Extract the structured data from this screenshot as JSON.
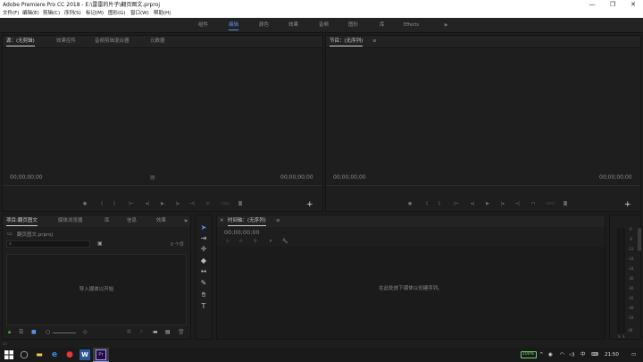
{
  "window": {
    "title": "Adobe Premiere Pro CC 2018 - E:\\雷雷的片子\\翻页图文.prproj",
    "controls": [
      "—",
      "❐",
      "✕"
    ]
  },
  "menu": [
    "文件(F)",
    "编辑(E)",
    "剪辑(C)",
    "序列(S)",
    "标记(M)",
    "图形(G)",
    "窗口(W)",
    "帮助(H)"
  ],
  "workspaces": {
    "tabs": [
      "组件",
      "编辑",
      "颜色",
      "效果",
      "音频",
      "图形",
      "库",
      "Effects"
    ],
    "active": "编辑",
    "overflow": "»"
  },
  "source_panel": {
    "tabs": [
      "源：(无剪辑)",
      "效果控件",
      "音频剪辑混合器",
      "元数据"
    ],
    "timecode_left": "00;00;00;00",
    "timecode_right": "00;00;00;00",
    "add": "+"
  },
  "program_panel": {
    "title": "节目：(无序列)",
    "menu": "≡",
    "timecode_left": "00;00;00;00",
    "timecode_right": "00;00;00;00",
    "add": "+"
  },
  "project_panel": {
    "tabs": [
      "项目:翻页图文",
      "媒体浏览器",
      "库",
      "信息",
      "效果"
    ],
    "overflow": "»",
    "file": "翻页图文.prproj",
    "search_placeholder": "",
    "item_count": "0 个项",
    "empty_text": "导入媒体以开始"
  },
  "timeline_panel": {
    "title": "时间轴：(无序列)",
    "menu": "≡",
    "timecode": "00;00;00;00",
    "empty_text": "在此处放下媒体以创建序列。"
  },
  "audio_meter": {
    "labels": [
      "0",
      "-6",
      "-12",
      "-18",
      "-24",
      "-30",
      "-36",
      "-42",
      "-48",
      "-54",
      "dB"
    ],
    "solo": "S"
  },
  "taskbar": {
    "battery": "100%",
    "ime": "中",
    "time": "21:50"
  }
}
